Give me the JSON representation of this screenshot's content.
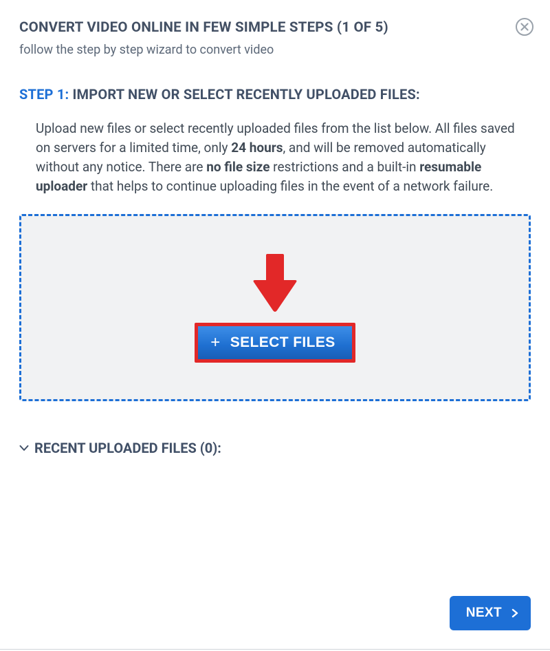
{
  "header": {
    "title": "CONVERT VIDEO ONLINE IN FEW SIMPLE STEPS (1 OF 5)",
    "subtitle": "follow the step by step wizard to convert video"
  },
  "step": {
    "label": "STEP 1:",
    "heading": "IMPORT NEW OR SELECT RECENTLY UPLOADED FILES:",
    "desc_parts": {
      "p1": "Upload new files or select recently uploaded files from the list below. All files saved on servers for a limited time, only ",
      "b1": "24 hours",
      "p2": ", and will be removed automatically without any notice. There are ",
      "b2": "no file size",
      "p3": " restrictions and a built-in ",
      "b3": "resumable uploader",
      "p4": " that helps to continue uploading files in the event of a network failure."
    }
  },
  "dropzone": {
    "select_button_label": "SELECT FILES"
  },
  "recent": {
    "label": "RECENT UPLOADED FILES (0):",
    "count": 0
  },
  "footer": {
    "next_label": "NEXT"
  },
  "colors": {
    "accent": "#1d6fd6",
    "highlight_border": "#e22828",
    "arrow_fill": "#e22828"
  }
}
